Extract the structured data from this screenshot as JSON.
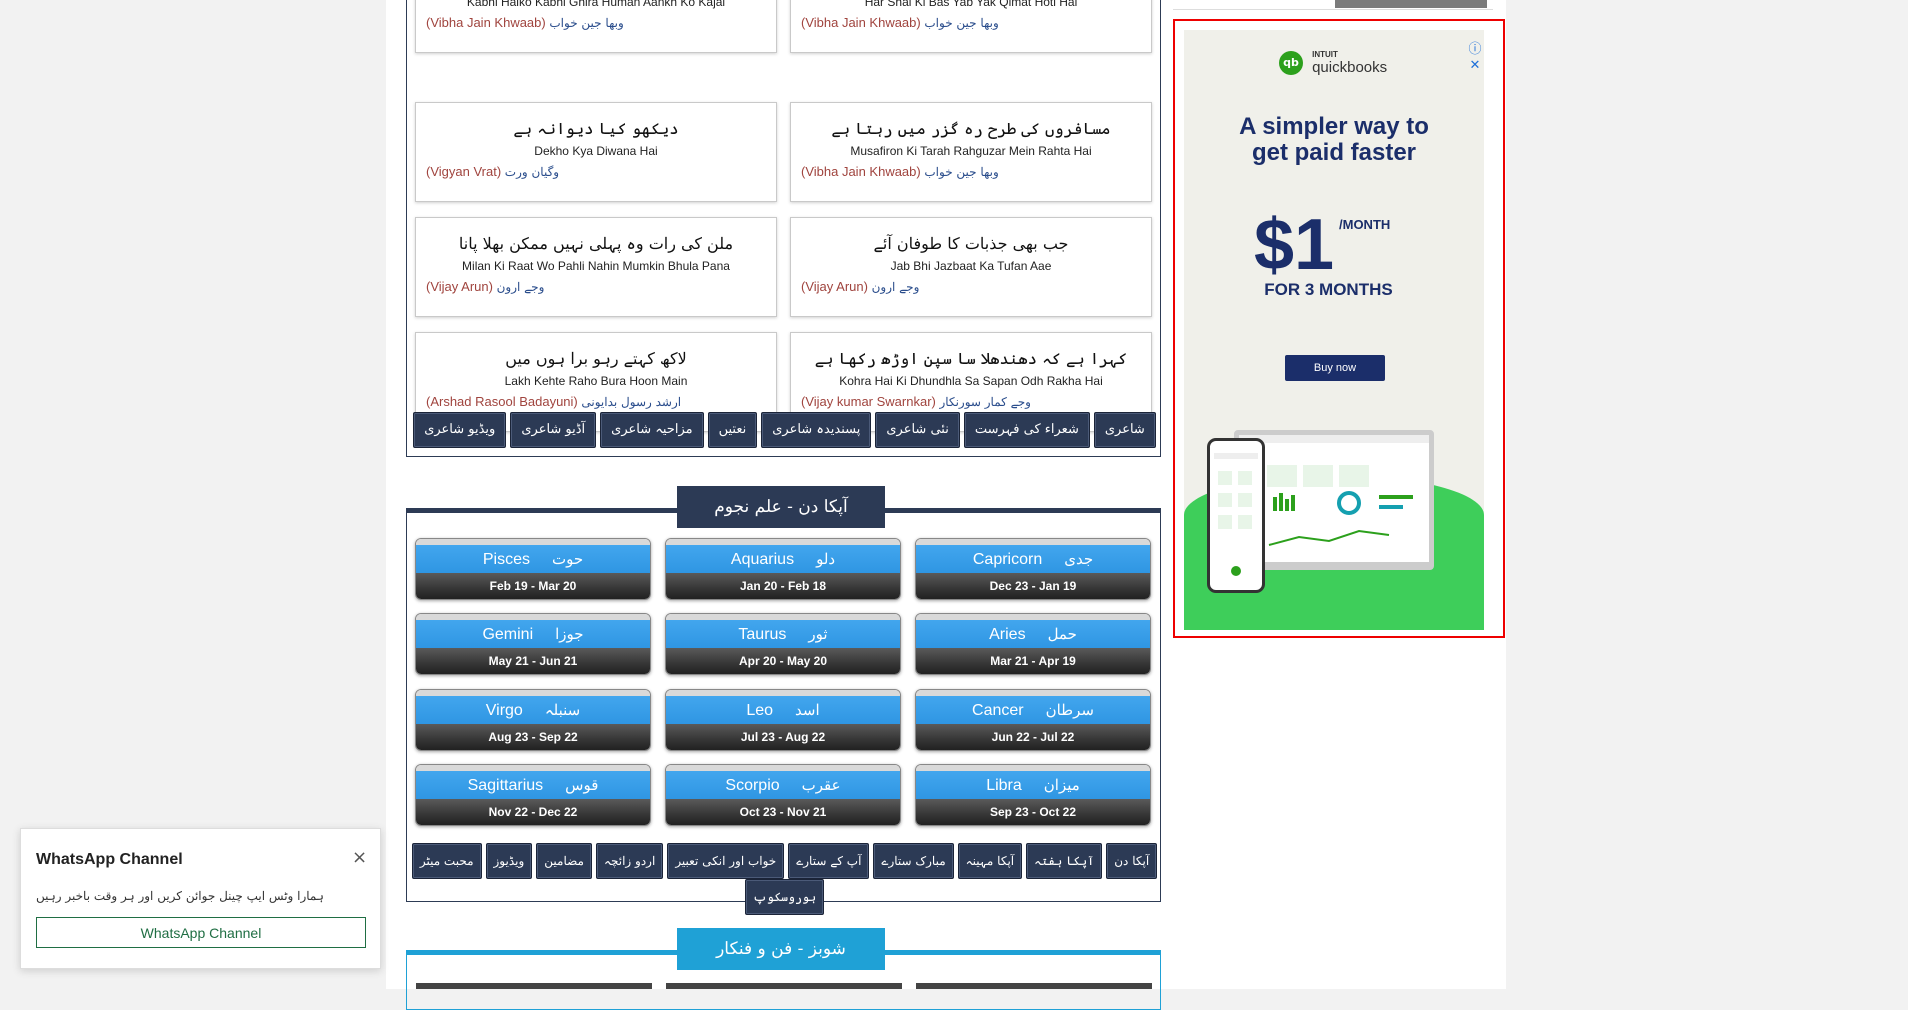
{
  "poems": [
    {
      "urdu": "",
      "roman": "Kabhi Haiko Kabhi Ghira Human Aankh Ko Kajal",
      "author_en": "(Vibha Jain Khwaab)",
      "author_ur": "وبھا جین خواب"
    },
    {
      "urdu": "",
      "roman": "Har Shai Ki Bas Yab Yak Qimat Hoti Hai",
      "author_en": "(Vibha Jain Khwaab)",
      "author_ur": "وبھا جین خواب"
    },
    {
      "urdu": "دیکھو کیا دیوانہ ہے",
      "roman": "Dekho Kya Diwana Hai",
      "author_en": "(Vigyan Vrat)",
      "author_ur": "وگیان ورت"
    },
    {
      "urdu": "مسافروں کی طرح رہ گزر میں رہتا ہے",
      "roman": "Musafiron Ki Tarah Rahguzar Mein Rahta Hai",
      "author_en": "(Vibha Jain Khwaab)",
      "author_ur": "وبھا جین خواب"
    },
    {
      "urdu": "ملن کی رات وہ پہلی نہیں ممکن بھلا پانا",
      "roman": "Milan Ki Raat Wo Pahli Nahin Mumkin Bhula Pana",
      "author_en": "(Vijay Arun)",
      "author_ur": "وجے ارون"
    },
    {
      "urdu": "جب بھی جذبات کا طوفان آئے",
      "roman": "Jab Bhi Jazbaat Ka Tufan Aae",
      "author_en": "(Vijay Arun)",
      "author_ur": "وجے ارون"
    },
    {
      "urdu": "لاکھ کہتے رہو برا ہوں میں",
      "roman": "Lakh Kehte Raho Bura Hoon Main",
      "author_en": "(Arshad Rasool Badayuni)",
      "author_ur": "ارشد رسول بدایونی"
    },
    {
      "urdu": "کہرا ہے کہ دھندھلا سا سپن اوڑھ رکھا ہے",
      "roman": "Kohra Hai Ki Dhundhla Sa Sapan Odh Rakha Hai",
      "author_en": "(Vijay kumar Swarnkar)",
      "author_ur": "وجے کمار سورنکار"
    }
  ],
  "poetry_buttons": [
    "ویڈیو شاعری",
    "آڈیو شاعری",
    "مزاحیہ شاعری",
    "نعتیں",
    "پسندیدہ شاعری",
    "نئی شاعری",
    "شعراء کی فہرست",
    "شاعری"
  ],
  "horoscope": {
    "heading": "آپکا دن - علم نجوم",
    "signs": [
      {
        "en": "Pisces",
        "ur": "حوت",
        "dates": "Feb 19 - Mar 20"
      },
      {
        "en": "Aquarius",
        "ur": "دلو",
        "dates": "Jan 20 - Feb 18"
      },
      {
        "en": "Capricorn",
        "ur": "جدی",
        "dates": "Dec 23 - Jan 19"
      },
      {
        "en": "Gemini",
        "ur": "جوزا",
        "dates": "May 21 - Jun 21"
      },
      {
        "en": "Taurus",
        "ur": "ثور",
        "dates": "Apr 20 - May 20"
      },
      {
        "en": "Aries",
        "ur": "حمل",
        "dates": "Mar 21 - Apr 19"
      },
      {
        "en": "Virgo",
        "ur": "سنبلہ",
        "dates": "Aug 23 - Sep 22"
      },
      {
        "en": "Leo",
        "ur": "اسد",
        "dates": "Jul 23 - Aug 22"
      },
      {
        "en": "Cancer",
        "ur": "سرطان",
        "dates": "Jun 22 - Jul 22"
      },
      {
        "en": "Sagittarius",
        "ur": "قوس",
        "dates": "Nov 22 - Dec 22"
      },
      {
        "en": "Scorpio",
        "ur": "عقرب",
        "dates": "Oct 23 - Nov 21"
      },
      {
        "en": "Libra",
        "ur": "میزان",
        "dates": "Sep 23 - Oct 22"
      }
    ],
    "buttons": [
      "محبت میٹر",
      "ویڈیوز",
      "مضامین",
      "اردو زائچہ",
      "خواب اور انکی تعبیر",
      "آپ کے ستارے",
      "مبارک ستارے",
      "آپکا مہینہ",
      "آپکا ہفتہ",
      "آپکا دن",
      "ہوروسکوپ"
    ]
  },
  "section2_heading": "شوبز - فن و فنکار",
  "ad": {
    "brand_top": "INTUIT",
    "brand_name": "quickbooks",
    "logo_mark": "qb",
    "headline_1": "A simpler way to",
    "headline_2": "get paid faster",
    "price": "$1",
    "per_month": "/MONTH",
    "duration": "FOR 3 MONTHS",
    "cta": "Buy now",
    "brand_green": "#2ca01c",
    "navy": "#1b2e6a"
  },
  "whatsapp": {
    "title": "WhatsApp Channel",
    "message": "ہمارا وٹس ایپ چینل جوائن کریں اور ہر وقت باخبر رہیں",
    "button": "WhatsApp Channel",
    "close": "×"
  },
  "colors": {
    "navy": "#2c3a55",
    "sky": "#2f96e3",
    "cyan": "#1fa1d6",
    "ad_border": "#e00"
  }
}
